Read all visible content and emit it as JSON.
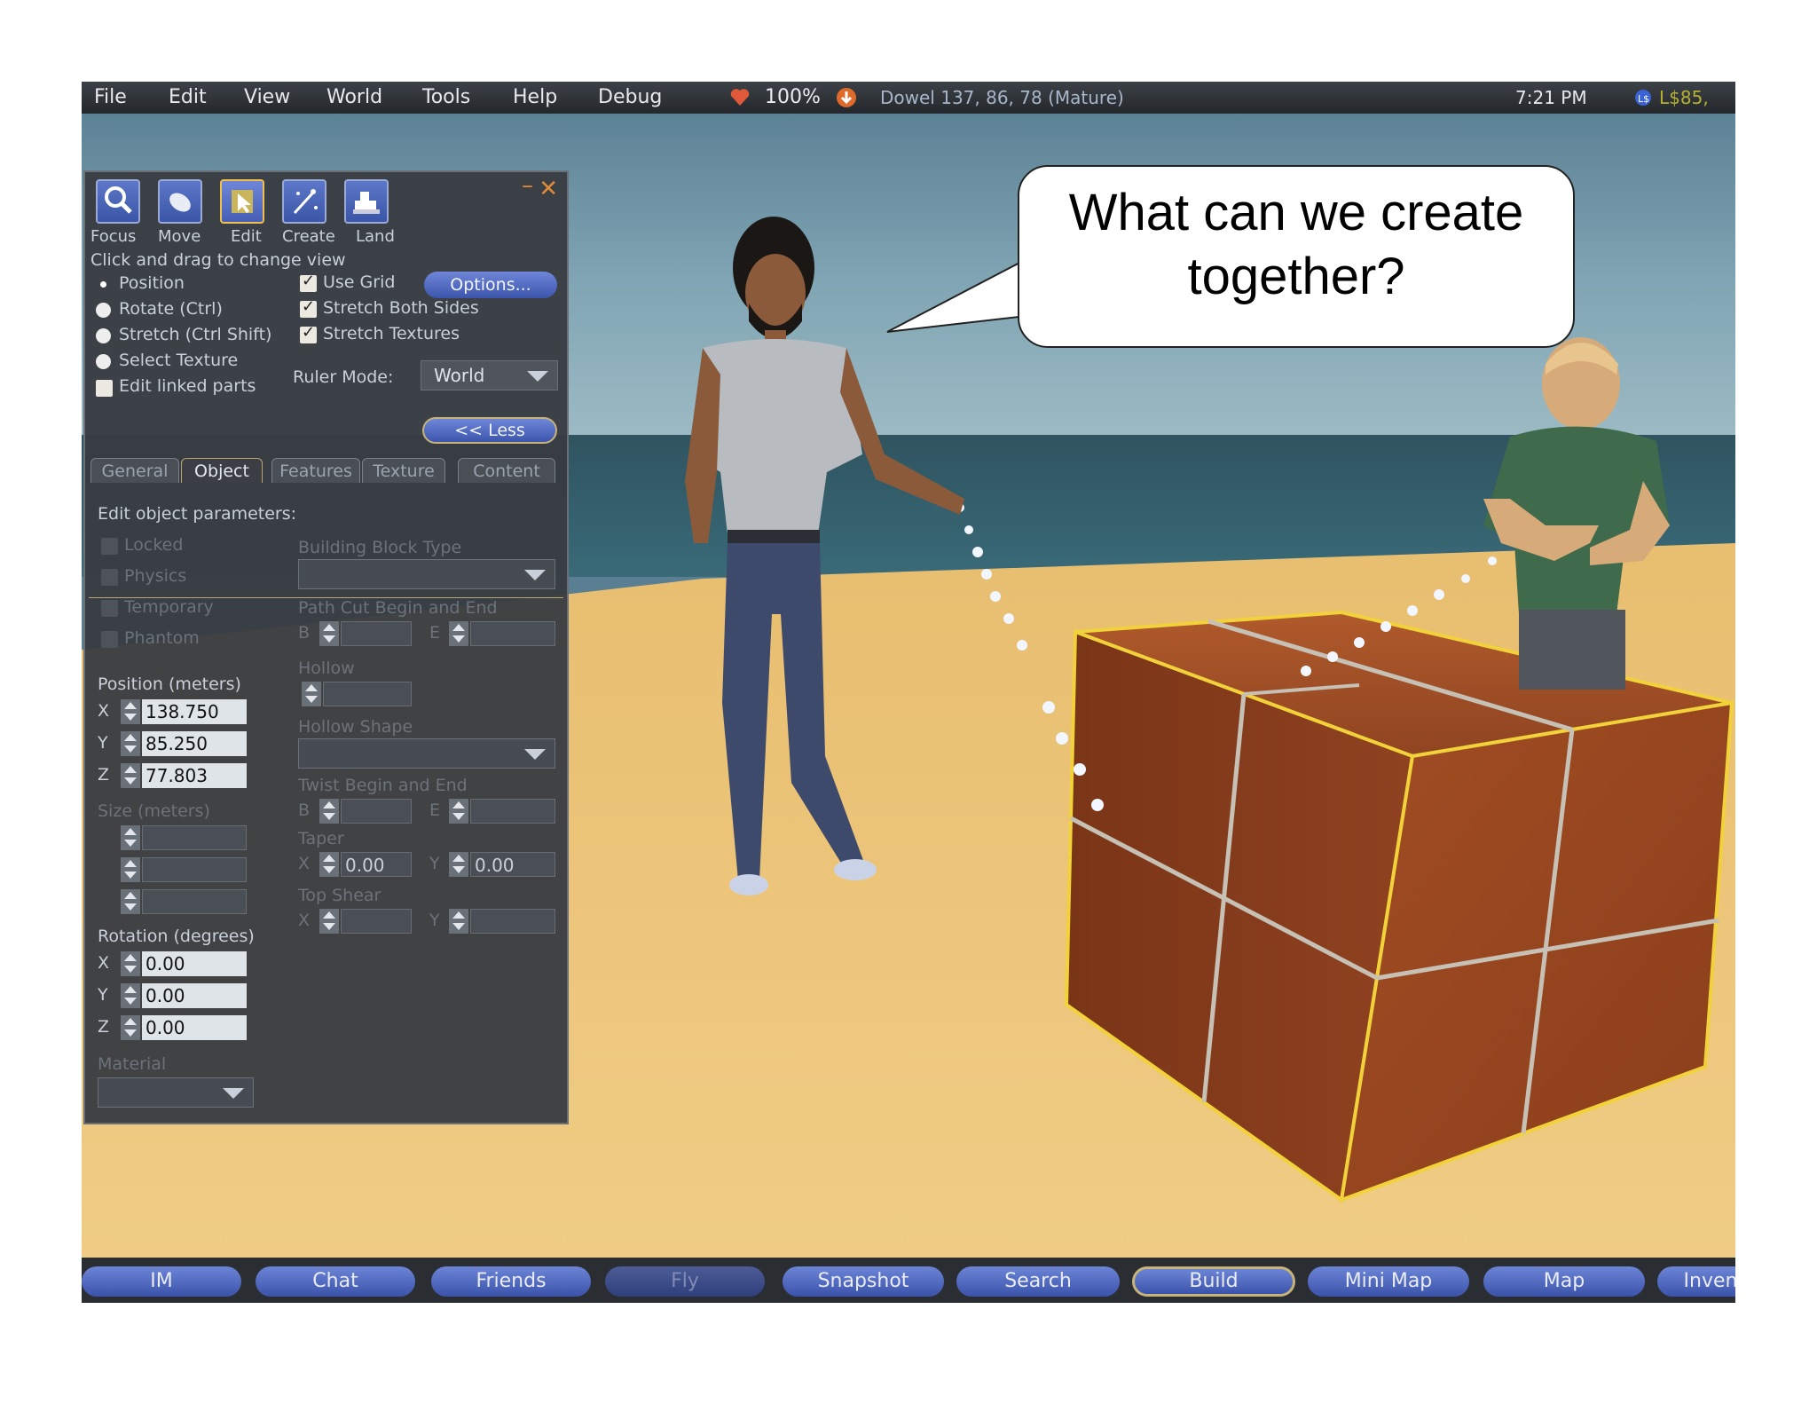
{
  "menubar": {
    "items": [
      "File",
      "Edit",
      "View",
      "World",
      "Tools",
      "Help",
      "Debug"
    ],
    "health": "100%",
    "location": "Dowel 137, 86, 78 (Mature)",
    "clock": "7:21 PM",
    "balance": "L$85,"
  },
  "speech_bubble": {
    "line1": "What can we create",
    "line2": "together?"
  },
  "build_panel": {
    "tools": [
      {
        "label": "Focus",
        "icon": "magnifier-icon"
      },
      {
        "label": "Move",
        "icon": "hand-icon"
      },
      {
        "label": "Edit",
        "icon": "cursor-icon"
      },
      {
        "label": "Create",
        "icon": "magic-wand-icon"
      },
      {
        "label": "Land",
        "icon": "bulldozer-icon"
      }
    ],
    "hint": "Click and drag to change view",
    "modes": [
      "Position",
      "Rotate (Ctrl)",
      "Stretch (Ctrl Shift)",
      "Select Texture"
    ],
    "edit_linked": "Edit linked parts",
    "checks": [
      "Use Grid",
      "Stretch Both Sides",
      "Stretch Textures"
    ],
    "options_button": "Options...",
    "ruler_label": "Ruler Mode:",
    "ruler_value": "World",
    "less_button": "<< Less",
    "tabs": [
      "General",
      "Object",
      "Features",
      "Texture",
      "Content"
    ],
    "section_title": "Edit object parameters:",
    "flags": [
      "Locked",
      "Physics",
      "Temporary",
      "Phantom"
    ],
    "position_title": "Position (meters)",
    "position": {
      "x": "138.750",
      "y": "85.250",
      "z": "77.803"
    },
    "size_title": "Size (meters)",
    "rotation_title": "Rotation (degrees)",
    "rotation": {
      "x": "0.00",
      "y": "0.00",
      "z": "0.00"
    },
    "material_label": "Material",
    "right_col": {
      "building_block": "Building Block Type",
      "path_cut": "Path Cut Begin and End",
      "hollow": "Hollow",
      "hollow_shape": "Hollow Shape",
      "twist": "Twist Begin and End",
      "taper": "Taper",
      "taper_x": "0.00",
      "taper_y": "0.00",
      "top_shear": "Top Shear"
    },
    "axis_labels": {
      "x": "X",
      "y": "Y",
      "z": "Z",
      "b": "B",
      "e": "E"
    }
  },
  "bottombar": {
    "buttons": [
      "IM",
      "Chat",
      "Friends",
      "Fly",
      "Snapshot",
      "Search",
      "Build",
      "Mini Map",
      "Map",
      "Inven"
    ]
  },
  "colors": {
    "sand": "#e3b868",
    "sky": "#6e93a6",
    "box": "#9a4a22",
    "selection": "#f2d23a",
    "button_blue": "#4f68bf"
  }
}
